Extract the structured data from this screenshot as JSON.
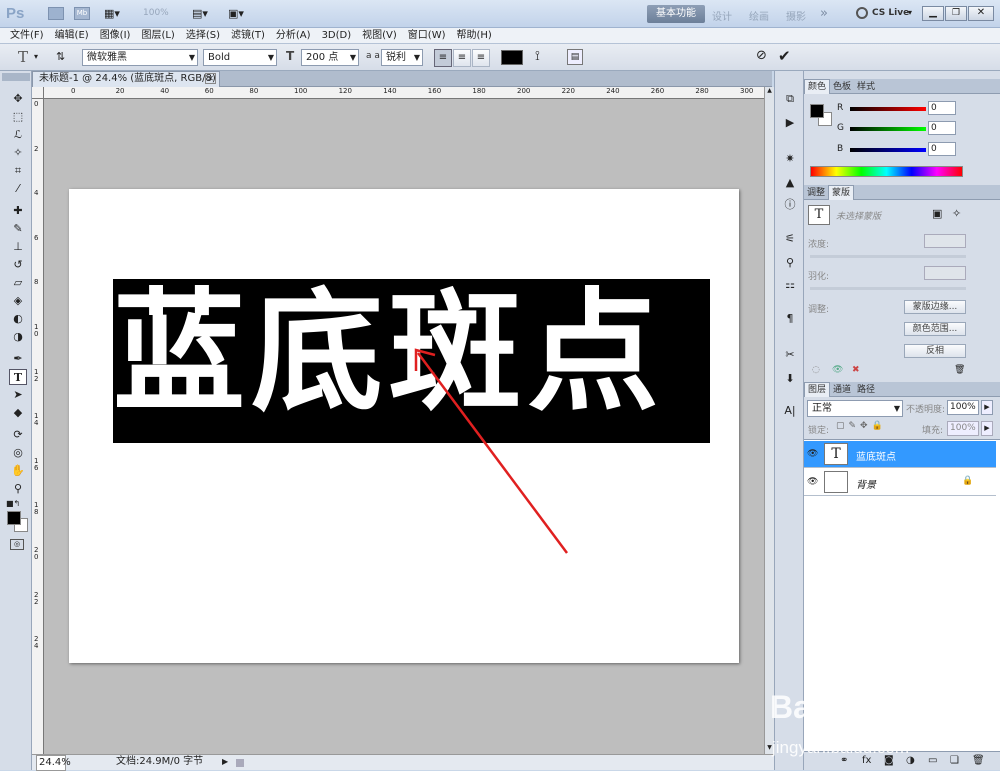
{
  "app": {
    "logo": "Ps",
    "zoom_display": "100%",
    "workspaces": [
      "基本功能",
      "设计",
      "绘画",
      "摄影"
    ],
    "workspace_more": "»",
    "cs_live": "CS Live"
  },
  "menu": [
    "文件(F)",
    "编辑(E)",
    "图像(I)",
    "图层(L)",
    "选择(S)",
    "滤镜(T)",
    "分析(A)",
    "3D(D)",
    "视图(V)",
    "窗口(W)",
    "帮助(H)"
  ],
  "options": {
    "tool_letter": "T",
    "font_family": "微软雅黑",
    "font_style": "Bold",
    "font_size": "200 点",
    "aa_label": "a a",
    "antialias": "锐利"
  },
  "document": {
    "tab_title": "未标题-1 @ 24.4% (蓝底斑点, RGB/8) *",
    "canvas_text": "蓝底斑点",
    "status_zoom": "24.4%",
    "status_doc": "文档:24.9M/0 字节"
  },
  "ruler": {
    "top": [
      "0",
      "20",
      "40",
      "60",
      "80",
      "100",
      "120",
      "140",
      "160",
      "180",
      "200",
      "220",
      "240",
      "260",
      "280",
      "300"
    ],
    "left": [
      "0",
      "2",
      "4",
      "6",
      "8",
      "10",
      "12",
      "14",
      "16",
      "18",
      "20",
      "22",
      "24"
    ]
  },
  "color_panel": {
    "tabs": [
      "颜色",
      "色板",
      "样式"
    ],
    "r_label": "R",
    "g_label": "G",
    "b_label": "B",
    "r": "0",
    "g": "0",
    "b": "0"
  },
  "adjust_panel": {
    "tabs": [
      "调整",
      "蒙版"
    ],
    "no_mask": "未选择蒙版",
    "density": "浓度:",
    "feather": "羽化:",
    "refine": "调整:",
    "btn_edge": "蒙版边缘...",
    "btn_range": "颜色范围...",
    "btn_invert": "反相"
  },
  "layers_panel": {
    "tabs": [
      "图层",
      "通道",
      "路径"
    ],
    "blend_mode": "正常",
    "opacity_label": "不透明度:",
    "opacity": "100%",
    "lock_label": "锁定:",
    "fill_label": "填充:",
    "fill": "100%",
    "layers": [
      {
        "name": "蓝底斑点",
        "thumb": "T",
        "selected": true
      },
      {
        "name": "背景",
        "thumb": "",
        "selected": false
      }
    ]
  },
  "watermark": {
    "brand": "Bai du 经验",
    "url": "jingyan.baidu.com"
  },
  "colors": {
    "selection": "#3399ff",
    "arrow": "#e02020"
  }
}
